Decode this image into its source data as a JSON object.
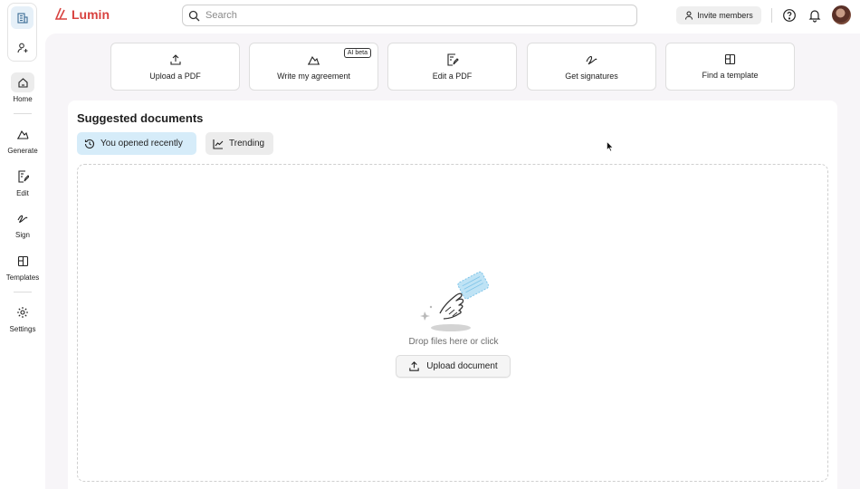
{
  "app": {
    "logo_text": "Lumin",
    "brand_color": "#d8423f"
  },
  "search": {
    "placeholder": "Search"
  },
  "header": {
    "invite_label": "Invite members"
  },
  "sidebar": {
    "items": [
      {
        "label": "Home",
        "icon": "home-icon",
        "active": true
      },
      {
        "label": "Generate",
        "icon": "generate-icon"
      },
      {
        "label": "Edit",
        "icon": "edit-icon"
      },
      {
        "label": "Sign",
        "icon": "sign-icon"
      },
      {
        "label": "Templates",
        "icon": "templates-icon"
      },
      {
        "label": "Settings",
        "icon": "settings-icon"
      }
    ]
  },
  "quick_actions": [
    {
      "label": "Upload a PDF",
      "icon": "upload-icon"
    },
    {
      "label": "Write my agreement",
      "icon": "write-icon",
      "badge": "AI beta"
    },
    {
      "label": "Edit a PDF",
      "icon": "edit-pdf-icon"
    },
    {
      "label": "Get signatures",
      "icon": "signature-icon"
    },
    {
      "label": "Find a template",
      "icon": "template-icon"
    }
  ],
  "suggested": {
    "title": "Suggested documents",
    "tabs": [
      {
        "label": "You opened recently",
        "active": true
      },
      {
        "label": "Trending",
        "active": false
      }
    ],
    "drop_text": "Drop files here or click",
    "upload_label": "Upload document"
  },
  "colors": {
    "active_tab": "#d6ecf9",
    "panel_bg": "#f7f5f8"
  }
}
